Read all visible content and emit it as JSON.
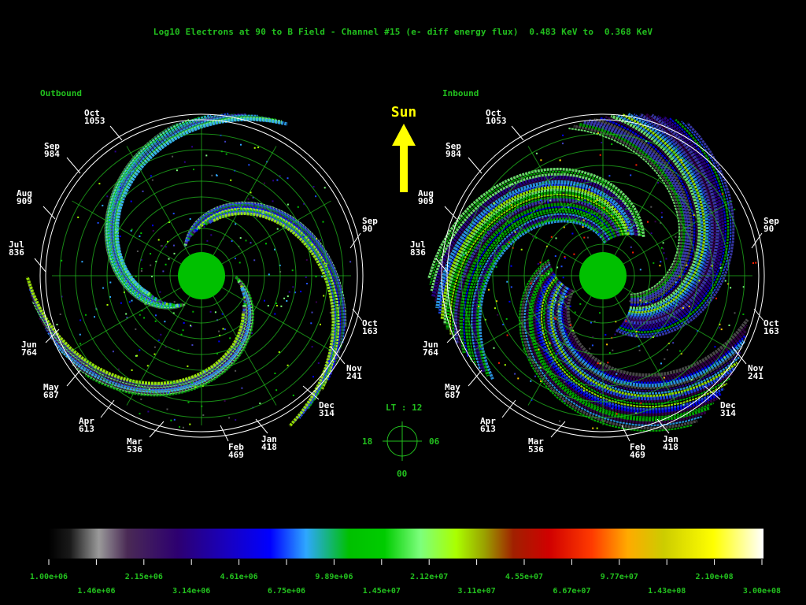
{
  "title": "Log10 Electrons at 90 to B Field - Channel #15 (e- diff energy flux)  0.483 KeV to  0.368 KeV",
  "colors": {
    "accent": "#22c01e",
    "label": "#ffffff",
    "sun": "#ffff00",
    "planet": "#00c000"
  },
  "sun_label": "Sun",
  "lt_dial": {
    "label": "LT :  12",
    "left": "18",
    "right": "06",
    "bottom": "00"
  },
  "chart_data": [
    {
      "type": "polar",
      "panel": "Outbound",
      "grid": true,
      "month_labels": [
        {
          "month": "Oct",
          "value": "1053"
        },
        {
          "month": "Sep",
          "value": "984"
        },
        {
          "month": "Aug",
          "value": "909"
        },
        {
          "month": "Jul",
          "value": "836"
        },
        {
          "month": "Jun",
          "value": "764"
        },
        {
          "month": "May",
          "value": "687"
        },
        {
          "month": "Apr",
          "value": "613"
        },
        {
          "month": "Mar",
          "value": "536"
        },
        {
          "month": "Feb",
          "value": "469"
        },
        {
          "month": "Jan",
          "value": "418"
        },
        {
          "month": "Dec",
          "value": "314"
        },
        {
          "month": "Nov",
          "value": "241"
        },
        {
          "month": "Oct",
          "value": "163"
        },
        {
          "month": "Sep",
          "value": "90"
        }
      ]
    },
    {
      "type": "polar",
      "panel": "Inbound",
      "grid": true,
      "month_labels": [
        {
          "month": "Oct",
          "value": "1053"
        },
        {
          "month": "Sep",
          "value": "984"
        },
        {
          "month": "Aug",
          "value": "909"
        },
        {
          "month": "Jul",
          "value": "836"
        },
        {
          "month": "Jun",
          "value": "764"
        },
        {
          "month": "May",
          "value": "687"
        },
        {
          "month": "Apr",
          "value": "613"
        },
        {
          "month": "Mar",
          "value": "536"
        },
        {
          "month": "Feb",
          "value": "469"
        },
        {
          "month": "Jan",
          "value": "418"
        },
        {
          "month": "Dec",
          "value": "314"
        },
        {
          "month": "Nov",
          "value": "241"
        },
        {
          "month": "Oct",
          "value": "163"
        },
        {
          "month": "Sep",
          "value": "90"
        }
      ]
    },
    {
      "type": "colorbar",
      "ticks_top": [
        "1.00e+06",
        "2.15e+06",
        "4.61e+06",
        "9.89e+06",
        "2.12e+07",
        "4.55e+07",
        "9.77e+07",
        "2.10e+08"
      ],
      "ticks_bottom": [
        "1.46e+06",
        "3.14e+06",
        "6.75e+06",
        "1.45e+07",
        "3.11e+07",
        "6.67e+07",
        "1.43e+08",
        "3.00e+08"
      ],
      "range": [
        1000000,
        300000000
      ],
      "scale": "log",
      "colormap": [
        "#000000",
        "#9a9a9a",
        "#3a0050",
        "#2d0090",
        "#0000ff",
        "#2ea7ff",
        "#00c000",
        "#7dff7d",
        "#aaff00",
        "#c00000",
        "#ff3b00",
        "#ffcc00",
        "#ffff00",
        "#ffffff"
      ]
    }
  ]
}
